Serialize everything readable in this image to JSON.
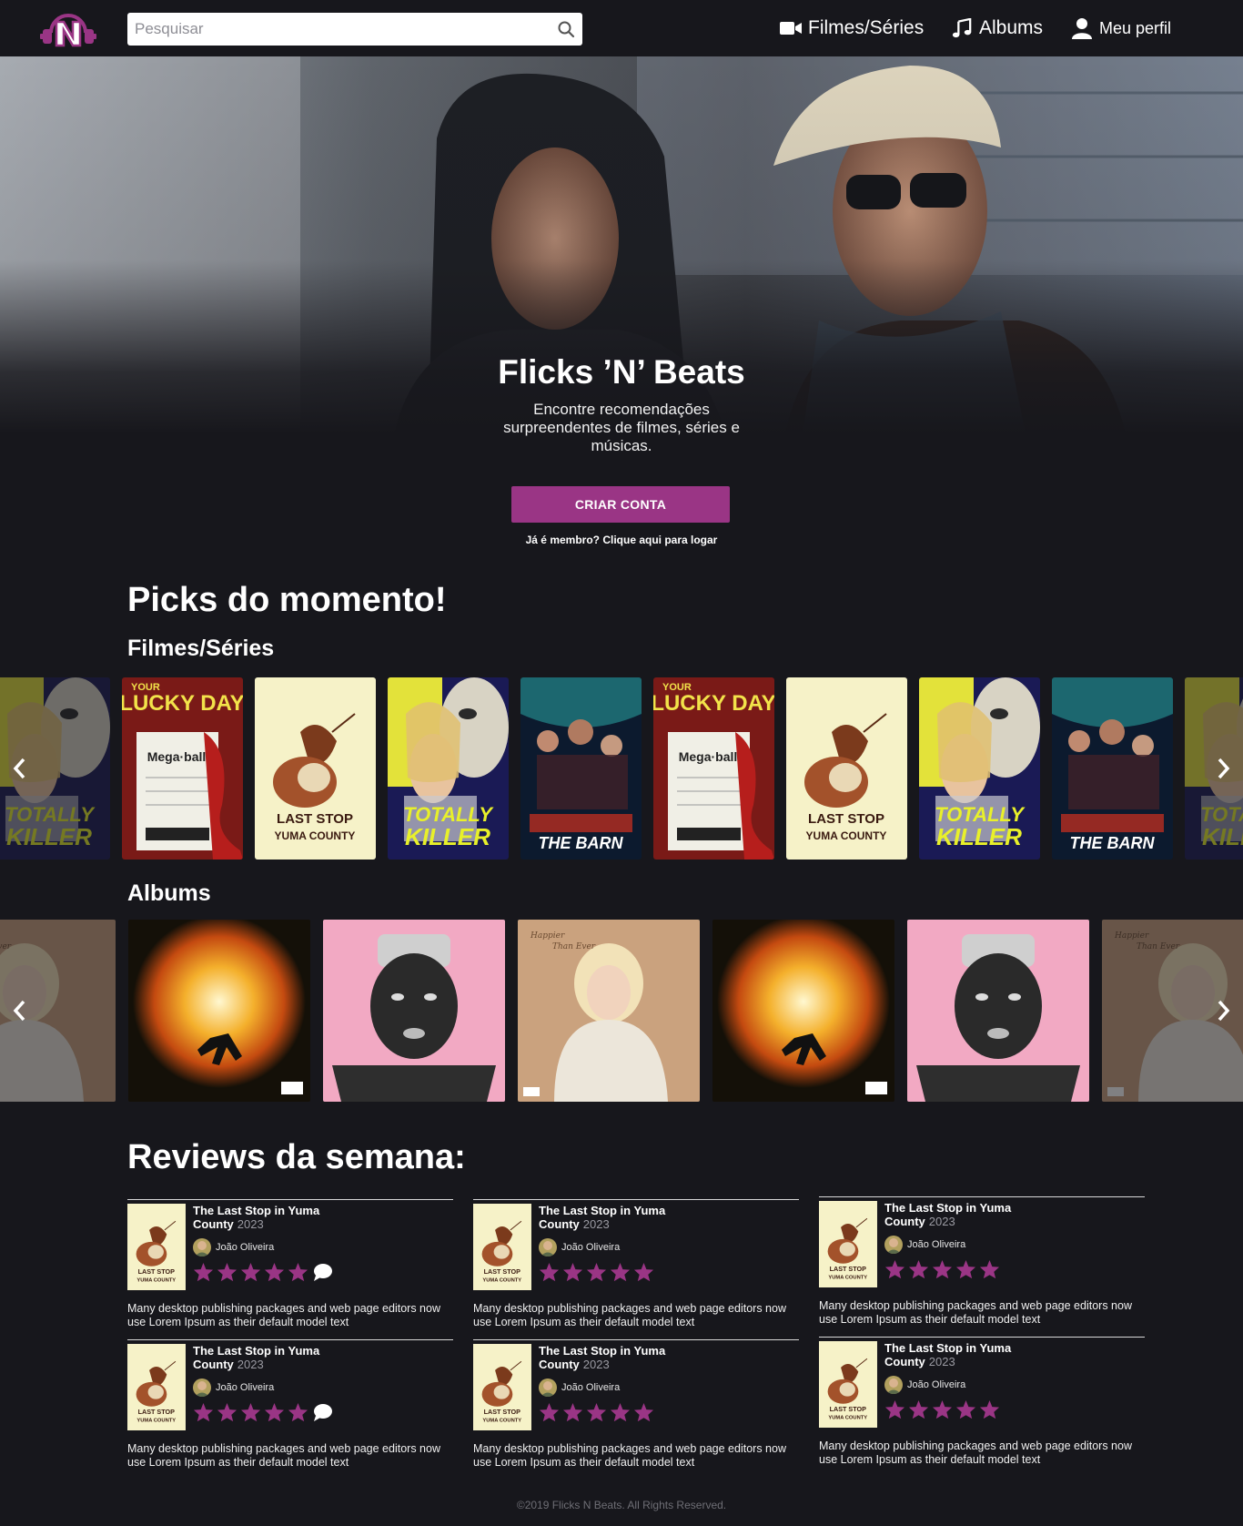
{
  "nav": {
    "search_placeholder": "Pesquisar",
    "films_label": "Filmes/Séries",
    "albums_label": "Albums",
    "profile_label": "Meu perfil"
  },
  "hero": {
    "title": "Flicks ’N’ Beats",
    "subtitle": "Encontre recomendações surpreendentes de filmes, séries e músicas.",
    "cta_label": "CRIAR CONTA",
    "login_text": "Já é membro? Clique aqui para logar"
  },
  "picks": {
    "title": "Picks do momento!",
    "films_title": "Filmes/Séries",
    "albums_title": "Albums",
    "films": [
      {
        "name": "TOTALLY KILLER",
        "style": "killer"
      },
      {
        "name": "LUCKY DAY",
        "style": "lucky"
      },
      {
        "name": "LAST STOP IN YUMA COUNTY",
        "style": "yuma"
      },
      {
        "name": "TOTALLY KILLER",
        "style": "killer"
      },
      {
        "name": "THE BARN",
        "style": "barn"
      },
      {
        "name": "LUCKY DAY",
        "style": "lucky"
      },
      {
        "name": "LAST STOP IN YUMA COUNTY",
        "style": "yuma"
      },
      {
        "name": "TOTALLY KILLER",
        "style": "killer"
      },
      {
        "name": "THE BARN",
        "style": "barn"
      },
      {
        "name": "TOTALLY KILLER",
        "style": "killer"
      }
    ],
    "albums": [
      {
        "style": "billie"
      },
      {
        "style": "fire"
      },
      {
        "style": "igor"
      },
      {
        "style": "billie"
      },
      {
        "style": "fire"
      },
      {
        "style": "igor"
      },
      {
        "style": "billie"
      }
    ]
  },
  "reviews": {
    "title": "Reviews da semana:",
    "items": [
      {
        "title": "The Last Stop in Yuma County",
        "year": "2023",
        "user": "João Oliveira",
        "stars": 5,
        "has_comment": true,
        "text": "Many desktop publishing packages and web page editors now use Lorem Ipsum as their default model text"
      },
      {
        "title": "The Last Stop in Yuma County",
        "year": "2023",
        "user": "João Oliveira",
        "stars": 5,
        "has_comment": false,
        "text": "Many desktop publishing packages and web page editors now use Lorem Ipsum as their default model text"
      },
      {
        "title": "The Last Stop in Yuma County",
        "year": "2023",
        "user": "João Oliveira",
        "stars": 5,
        "has_comment": false,
        "text": "Many desktop publishing packages and web page editors now use Lorem Ipsum as their default model text"
      },
      {
        "title": "The Last Stop in Yuma County",
        "year": "2023",
        "user": "João Oliveira",
        "stars": 5,
        "has_comment": true,
        "text": "Many desktop publishing packages and web page editors now use Lorem Ipsum as their default model text"
      },
      {
        "title": "The Last Stop in Yuma County",
        "year": "2023",
        "user": "João Oliveira",
        "stars": 5,
        "has_comment": false,
        "text": "Many desktop publishing packages and web page editors now use Lorem Ipsum as their default model text"
      },
      {
        "title": "The Last Stop in Yuma County",
        "year": "2023",
        "user": "João Oliveira",
        "stars": 5,
        "has_comment": false,
        "text": "Many desktop publishing packages and web page editors now use Lorem Ipsum as their default model text"
      }
    ]
  },
  "footer": {
    "copyright": "©2019 Flicks N Beats. All Rights Reserved."
  },
  "colors": {
    "background": "#17171c",
    "accent": "#9a3585",
    "star": "#9a3585"
  },
  "icons": [
    "logo-icon",
    "search-icon",
    "video-camera-icon",
    "music-note-icon",
    "user-icon",
    "chevron-left-icon",
    "chevron-right-icon",
    "star-icon",
    "comment-icon"
  ]
}
